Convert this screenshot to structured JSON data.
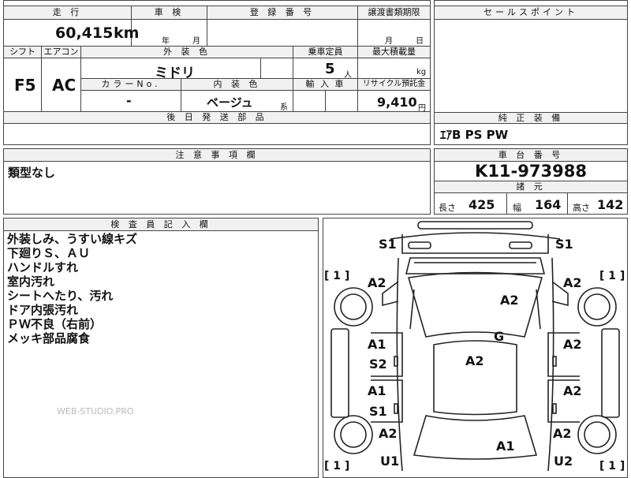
{
  "headers": {
    "mileage": "走 行",
    "inspection": "車 検",
    "registration": "登 録 番 号",
    "transfer_docs": "譲渡書類期限",
    "sales_point": "セールスポイント",
    "shift": "シフト",
    "aircon": "エアコン",
    "ext_color": "外 装 色",
    "capacity": "乗車定員",
    "max_load": "最大積載量",
    "color_no": "カラーNo.",
    "int_color": "内 装 色",
    "import": "輸 入 車",
    "recycle": "リサイクル預託金",
    "later_parts": "後 日 発 送 部 品",
    "genuine_equip": "純 正 装 備",
    "caution": "注 意 事 項 欄",
    "chassis": "車 台 番 号",
    "specs": "諸 元",
    "inspector": "検 査 員 記 入 欄"
  },
  "values": {
    "mileage": "60,415",
    "mileage_unit": "km",
    "inspection_year": "年",
    "inspection_month": "月",
    "transfer_month": "月",
    "transfer_day": "日",
    "shift": "F5",
    "aircon": "AC",
    "ext_color": "ミドリ",
    "capacity": "5",
    "capacity_unit": "人",
    "max_load_unit": "kg",
    "color_no": "-",
    "int_color": "ベージュ",
    "int_color_suffix": "系",
    "recycle": "9,410",
    "recycle_unit": "円",
    "genuine_equip": "ｴｱB PS PW",
    "caution": "類型なし",
    "chassis": "K11-973988",
    "length_label": "長さ",
    "length": "425",
    "width_label": "幅",
    "width": "164",
    "height_label": "高さ",
    "height": "142"
  },
  "inspector_notes": [
    "外装しみ、うすい線キズ",
    "下廻りＳ、ＡＵ",
    "ハンドルすれ",
    "室内汚れ",
    "シートへたり、汚れ",
    "ドア内張汚れ",
    "ＰＷ不良（右前）",
    "メッキ部品腐食"
  ],
  "watermark": "WEB-STUDIO.PRO",
  "diagram": {
    "marks": {
      "front_left": "S1",
      "front_right": "S1",
      "bracket_left": "[ 1 ]",
      "bracket_right": "[ 1 ]",
      "fender_left": "A2",
      "fender_right": "A2",
      "hood": "A2",
      "windshield": "G",
      "roof": "A2",
      "front_door_left": "A1",
      "front_door_left_2": "S2",
      "front_door_right": "A2",
      "rear_door_left": "A1",
      "rear_door_left_2": "S1",
      "rear_door_right": "A2",
      "rear_fender_left": "A2",
      "rear_fender_right": "A2",
      "trunk": "A1",
      "rear_left": "U1",
      "rear_right": "U2",
      "bracket_bottom_left": "[ 1 ]",
      "bracket_bottom_right": "[ 1 ]"
    }
  }
}
